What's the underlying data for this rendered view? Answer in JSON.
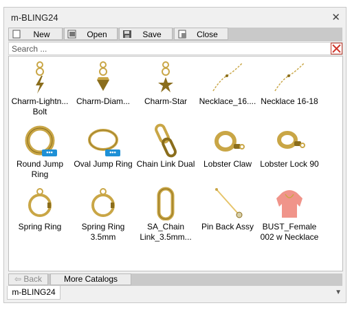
{
  "window": {
    "title": "m-BLING24"
  },
  "toolbar": {
    "new_label": "New",
    "open_label": "Open",
    "save_label": "Save",
    "close_label": "Close"
  },
  "search": {
    "placeholder": "Search ..."
  },
  "items": [
    {
      "label": "Charm-Lightn... Bolt",
      "line1": "Charm-Lightn...",
      "line2": "Bolt",
      "icon": "charm-lightning-bolt-icon"
    },
    {
      "label": "Charm-Diam...",
      "line1": "Charm-Diam...",
      "line2": "",
      "icon": "charm-diamond-icon"
    },
    {
      "label": "Charm-Star",
      "line1": "Charm-Star",
      "line2": "",
      "icon": "charm-star-icon"
    },
    {
      "label": "Necklace_16....",
      "line1": "Necklace_16....",
      "line2": "",
      "icon": "necklace-chain-icon"
    },
    {
      "label": "Necklace 16-18",
      "line1": "Necklace 16-18",
      "line2": "",
      "icon": "necklace-chain-icon"
    },
    {
      "label": "Round Jump Ring",
      "line1": "Round Jump",
      "line2": "Ring",
      "icon": "round-jump-ring-icon",
      "badge": "•••"
    },
    {
      "label": "Oval Jump Ring",
      "line1": "Oval Jump Ring",
      "line2": "",
      "icon": "oval-jump-ring-icon",
      "badge": "•••"
    },
    {
      "label": "Chain Link Dual",
      "line1": "Chain Link Dual",
      "line2": "",
      "icon": "chain-link-icon"
    },
    {
      "label": "Lobster Claw",
      "line1": "Lobster Claw",
      "line2": "",
      "icon": "lobster-claw-icon"
    },
    {
      "label": "Lobster Lock 90",
      "line1": "Lobster Lock 90",
      "line2": "",
      "icon": "lobster-lock-icon"
    },
    {
      "label": "Spring Ring",
      "line1": "Spring Ring",
      "line2": "",
      "icon": "spring-ring-icon"
    },
    {
      "label": "Spring Ring 3.5mm",
      "line1": "Spring Ring",
      "line2": "3.5mm",
      "icon": "spring-ring-icon"
    },
    {
      "label": "SA_Chain Link_3.5mm...",
      "line1": "SA_Chain",
      "line2": "Link_3.5mm...",
      "icon": "chain-link-oval-icon"
    },
    {
      "label": "Pin Back Assy",
      "line1": "Pin Back Assy",
      "line2": "",
      "icon": "pin-back-icon"
    },
    {
      "label": "BUST_Female 002 w Necklace",
      "line1": "BUST_Female",
      "line2": "002 w Necklace",
      "icon": "bust-icon"
    }
  ],
  "footer": {
    "back_label": "Back",
    "more_catalogs_label": "More Catalogs"
  },
  "tab": {
    "label": "m-BLING24"
  },
  "colors": {
    "gold": "#c9a646",
    "gold_dark": "#8a6d1c",
    "accent_blue": "#1e90d6",
    "clear_red": "#c0392b",
    "bust_pink": "#f0948a"
  }
}
